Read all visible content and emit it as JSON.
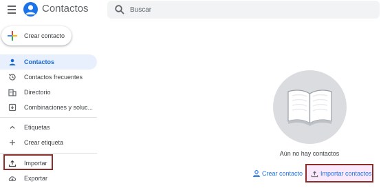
{
  "header": {
    "app_title": "Contactos",
    "menu_icon": "hamburger-menu-icon",
    "logo_icon": "contacts-person-icon"
  },
  "search": {
    "placeholder": "Buscar",
    "value": "",
    "icon": "search-icon"
  },
  "sidebar": {
    "create_button": {
      "label": "Crear contacto",
      "icon": "colorful-plus-icon"
    },
    "items": [
      {
        "label": "Contactos",
        "icon": "person-icon",
        "active": true
      },
      {
        "label": "Contactos frecuentes",
        "icon": "history-icon",
        "active": false
      },
      {
        "label": "Directorio",
        "icon": "directory-icon",
        "active": false
      },
      {
        "label": "Combinaciones y soluc...",
        "icon": "merge-icon",
        "active": false
      }
    ],
    "labels_section": {
      "header": "Etiquetas",
      "collapse_icon": "chevron-up-icon",
      "create_label": "Crear etiqueta",
      "create_icon": "plus-icon"
    },
    "import": {
      "label": "Importar",
      "icon": "upload-icon"
    },
    "export": {
      "label": "Exportar",
      "icon": "cloud-download-icon"
    }
  },
  "main": {
    "empty_illustration": "open-book-icon",
    "empty_text": "Aún no hay contactos",
    "create_link": {
      "label": "Crear contacto",
      "icon": "person-add-icon"
    },
    "import_link": {
      "label": "Importar contactos",
      "icon": "upload-icon"
    }
  },
  "colors": {
    "accent": "#1a73e8",
    "active_bg": "#e8f0fe",
    "highlight_border": "#8b2e2a",
    "illustration_bg": "#dadce0"
  }
}
